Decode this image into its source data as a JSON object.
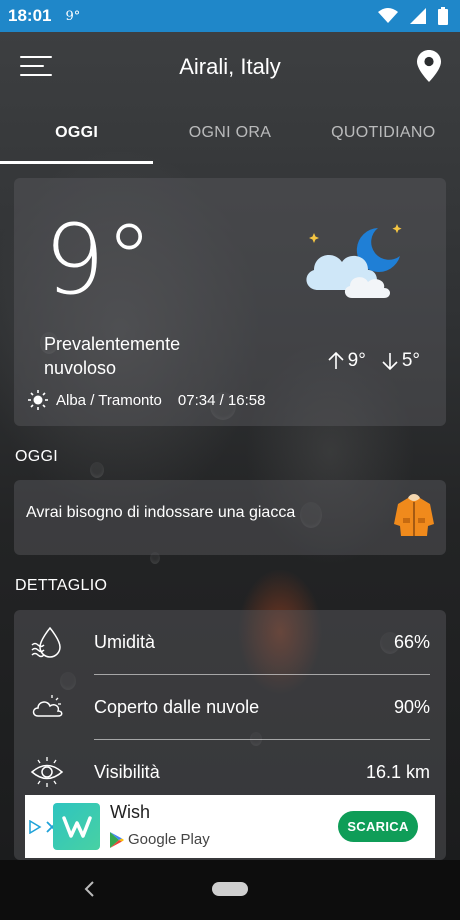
{
  "status_bar": {
    "time": "18:01",
    "temp": "9°",
    "icons": [
      "wifi-icon",
      "cellular-icon",
      "battery-icon"
    ]
  },
  "header": {
    "title": "Airali, Italy",
    "menu_icon": "hamburger-menu-icon",
    "location_icon": "location-pin-icon"
  },
  "tabs": [
    {
      "label": "OGGI",
      "active": true
    },
    {
      "label": "OGNI ORA",
      "active": false
    },
    {
      "label": "QUOTIDIANO",
      "active": false
    }
  ],
  "current": {
    "temperature": "9°",
    "condition": "Prevalentemente nuvoloso",
    "high": "9°",
    "low": "5°",
    "sun_label": "Alba / Tramonto",
    "sun_times": "07:34 / 16:58",
    "weather_icon": "cloudy-night-moon-icon"
  },
  "today": {
    "section_label": "OGGI",
    "tip": "Avrai bisogno di indossare una giacca",
    "tip_icon": "jacket-icon"
  },
  "details": {
    "section_label": "DETTAGLIO",
    "rows": [
      {
        "label": "Umidità",
        "value": "66%",
        "icon": "humidity-icon"
      },
      {
        "label": "Coperto dalle nuvole",
        "value": "90%",
        "icon": "cloud-cover-icon"
      },
      {
        "label": "Visibilità",
        "value": "16.1 km",
        "icon": "eye-icon"
      }
    ]
  },
  "ad": {
    "app_name": "Wish",
    "store": "Google Play",
    "cta": "SCARICA"
  },
  "colors": {
    "status_bar": "#1f87c9",
    "ad_button": "#0f9d58"
  }
}
